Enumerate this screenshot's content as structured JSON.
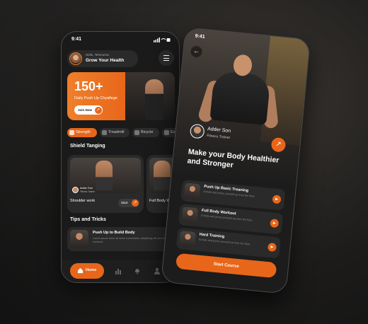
{
  "phone1": {
    "status_time": "9:41",
    "greeting": "Hello, Tehmurna",
    "headline": "Grow Your Health",
    "banner": {
      "big_number": "150+",
      "subtitle": "Daily Push Up Chyallege",
      "button_label": "Join Now"
    },
    "chips": [
      {
        "label": "Strength",
        "active": true
      },
      {
        "label": "Treadmill",
        "active": false
      },
      {
        "label": "Bicycle",
        "active": false
      },
      {
        "label": "Ex",
        "active": false
      }
    ],
    "section_workouts": "Shield Tanging",
    "workouts": [
      {
        "title": "Shoulder work",
        "trainer_name": "Adder Son",
        "trainer_role": "Fitness Trainer",
        "button": "Start"
      },
      {
        "title": "Full Body Work",
        "trainer_name": "",
        "trainer_role": "",
        "button": ""
      }
    ],
    "section_tips": "Tips and Tricks",
    "tip": {
      "title": "Push Up to Build Body",
      "desc": "Lorem ipsum dolor sit amet consectetur adipiscing elit sed do eiusmod"
    },
    "tabbar": {
      "home_label": "Home"
    }
  },
  "phone2": {
    "status_time": "9:41",
    "trainer_name": "Adder Son",
    "trainer_role": "Fitness Trainer",
    "headline": "Make your Body Healthier and Stronger",
    "courses": [
      {
        "title": "Push Up Basic Treaning",
        "desc": "Exhale and press yourself up from the floor."
      },
      {
        "title": "Full Body Workout",
        "desc": "Exhale and press yourself up from the floor."
      },
      {
        "title": "Hard Training",
        "desc": "Exhale and press yourself up from the floor."
      }
    ],
    "start_button": "Start Course"
  },
  "colors": {
    "accent": "#e8661a",
    "card": "#2a2a2a",
    "background": "#1a1a1a"
  }
}
